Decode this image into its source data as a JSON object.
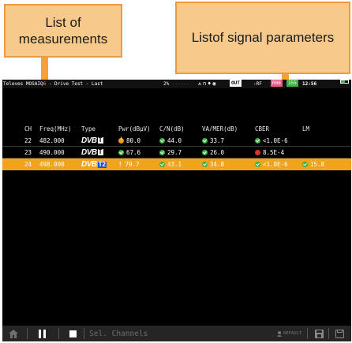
{
  "callouts": {
    "left": "List of measurements",
    "right": "Listof signal parameters"
  },
  "status_bar": {
    "title_prefix": "Televes MOSAIQ",
    "title_accent": "6",
    "title_rest": " - Drive Test - Last",
    "battery_pct": "2%",
    "signal_dim": "------",
    "icons": [
      "antenna-icon",
      "headphones-icon",
      "location-icon",
      "target-icon"
    ],
    "out_label": "OUT",
    "rf_label": "RF",
    "channel_badge_1": "R06",
    "channel_badge_2": "155",
    "time": "12:56"
  },
  "table": {
    "headers": [
      "CH",
      "Freq(MHz)",
      "Type",
      "Pwr(dBµV)",
      "C/N(dB)",
      "VA/MER(dB)",
      "CBER",
      "LM"
    ],
    "rows": [
      {
        "ch": "22",
        "freq": "482.000",
        "type_main": "DVB",
        "type_suffix": "T",
        "pwr": "80.0",
        "pwr_status": "warn",
        "cn": "44.0",
        "cn_status": "ok",
        "mer": "33.7",
        "mer_status": "ok",
        "ber": "<1.0E-6",
        "ber_status": "ok",
        "lm": "",
        "lm_status": "",
        "selected": false
      },
      {
        "ch": "23",
        "freq": "490.000",
        "type_main": "DVB",
        "type_suffix": "T",
        "pwr": "67.6",
        "pwr_status": "ok",
        "cn": "29.7",
        "cn_status": "ok",
        "mer": "26.0",
        "mer_status": "ok",
        "ber": "8.5E-4",
        "ber_status": "err",
        "lm": "",
        "lm_status": "",
        "selected": false
      },
      {
        "ch": "24",
        "freq": "498.000",
        "type_main": "DVB",
        "type_suffix": "T2",
        "pwr": "79.7",
        "pwr_status": "warn-plain",
        "cn": "43.1",
        "cn_status": "ok",
        "mer": "34.8",
        "mer_status": "ok",
        "ber": "<1.0E-6",
        "ber_status": "ok",
        "lm": "15.8",
        "lm_status": "ok",
        "selected": true
      }
    ]
  },
  "toolbar": {
    "home_icon": "home-icon",
    "pause_icon": "pause-icon",
    "stop_icon": "stop-icon",
    "sel_channels": "Sel. Channels",
    "default_label": "DEFAULT",
    "save_icon": "save-icon",
    "save_as_icon": "save-as-icon"
  },
  "colors": {
    "accent": "#f1a31c",
    "ok": "#3cb043",
    "warn": "#f39c12",
    "error": "#d9342b",
    "callout_fill": "#f7c98a",
    "callout_border": "#ee9a3a"
  }
}
